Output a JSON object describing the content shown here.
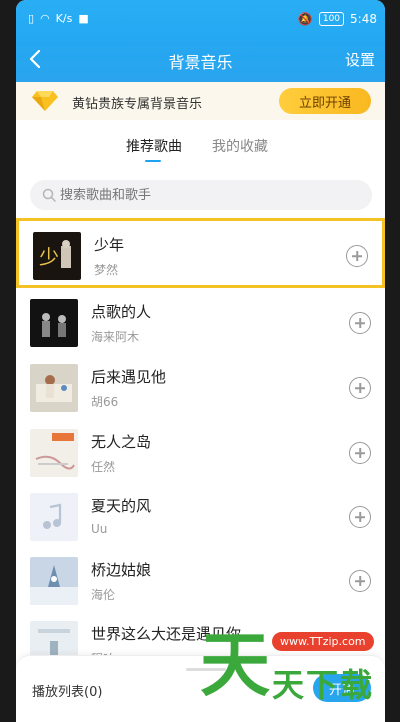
{
  "status_bar": {
    "left_text": "K/s",
    "battery": "100",
    "time": "5:48"
  },
  "header": {
    "back_icon": "chevron-left-icon",
    "title": "背景音乐",
    "settings_label": "设置"
  },
  "vip_banner": {
    "text": "黄钻贵族专属背景音乐",
    "button_label": "立即开通",
    "icon": "diamond-icon"
  },
  "tabs": [
    {
      "label": "推荐歌曲",
      "active": true
    },
    {
      "label": "我的收藏",
      "active": false
    }
  ],
  "search": {
    "placeholder": "搜索歌曲和歌手",
    "value": ""
  },
  "songs": [
    {
      "title": "少年",
      "artist": "梦然",
      "selected": true
    },
    {
      "title": "点歌的人",
      "artist": "海来阿木"
    },
    {
      "title": "后来遇见他",
      "artist": "胡66"
    },
    {
      "title": "无人之岛",
      "artist": "任然"
    },
    {
      "title": "夏天的风",
      "artist": "Uu"
    },
    {
      "title": "桥边姑娘",
      "artist": "海伦"
    },
    {
      "title": "世界这么大还是遇见你",
      "artist": "程响"
    }
  ],
  "bottom": {
    "playlist_label": "播放列表(0)",
    "open_label": "开通"
  },
  "watermark": {
    "big": "天",
    "small": "天下载",
    "url": "www.TTzip.com"
  },
  "colors": {
    "accent": "#24a8f1",
    "highlight": "#f5c226",
    "vip_button": "#f9b820"
  }
}
